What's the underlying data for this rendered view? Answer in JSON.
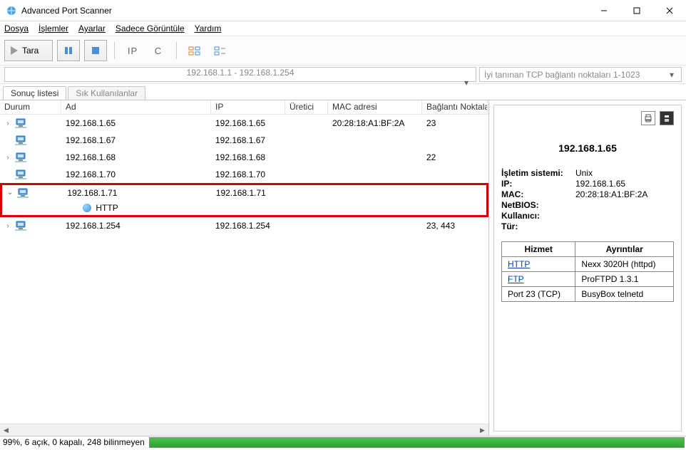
{
  "window": {
    "title": "Advanced Port Scanner"
  },
  "menu": {
    "file": "Dosya",
    "actions": "İşlemler",
    "settings": "Ayarlar",
    "viewonly": "Sadece Görüntüle",
    "help": "Yardım"
  },
  "toolbar": {
    "scan": "Tara",
    "ip": "IP",
    "c": "C"
  },
  "filter": {
    "range": "192.168.1.1 - 192.168.1.254",
    "ports": "İyi tanınan TCP bağlantı noktaları 1-1023"
  },
  "tabs": {
    "results": "Sonuç listesi",
    "favorites": "Sık Kullanılanlar"
  },
  "columns": {
    "durum": "Durum",
    "ad": "Ad",
    "ip": "IP",
    "uretici": "Üretici",
    "mac": "MAC adresi",
    "port": "Bağlantı Noktaları"
  },
  "rows": [
    {
      "expand": ">",
      "ad": "192.168.1.65",
      "ip": "192.168.1.65",
      "mac": "20:28:18:A1:BF:2A",
      "port": "23",
      "highlighted": false
    },
    {
      "expand": "",
      "ad": "192.168.1.67",
      "ip": "192.168.1.67",
      "mac": "",
      "port": "",
      "highlighted": false
    },
    {
      "expand": ">",
      "ad": "192.168.1.68",
      "ip": "192.168.1.68",
      "mac": "",
      "port": "22",
      "highlighted": false
    },
    {
      "expand": "",
      "ad": "192.168.1.70",
      "ip": "192.168.1.70",
      "mac": "",
      "port": "",
      "highlighted": false
    },
    {
      "expand": "v",
      "ad": "192.168.1.71",
      "ip": "192.168.1.71",
      "mac": "",
      "port": "",
      "highlighted": true,
      "child": "HTTP"
    },
    {
      "expand": ">",
      "ad": "192.168.1.254",
      "ip": "192.168.1.254",
      "mac": "",
      "port": "23, 443",
      "highlighted": false
    }
  ],
  "detail": {
    "title": "192.168.1.65",
    "os_label": "İşletim sistemi:",
    "os": "Unix",
    "ip_label": "IP:",
    "ip": "192.168.1.65",
    "mac_label": "MAC:",
    "mac": "20:28:18:A1:BF:2A",
    "netbios_label": "NetBIOS:",
    "user_label": "Kullanıcı:",
    "type_label": "Tür:",
    "svc_header": "Hizmet",
    "det_header": "Ayrıntılar",
    "services": [
      {
        "name": "HTTP",
        "link": true,
        "detail": "Nexx 3020H (httpd)"
      },
      {
        "name": "FTP",
        "link": true,
        "detail": "ProFTPD 1.3.1"
      },
      {
        "name": "Port 23 (TCP)",
        "link": false,
        "detail": "BusyBox telnetd"
      }
    ]
  },
  "status": "99%, 6 açık, 0 kapalı, 248 bilinmeyen"
}
